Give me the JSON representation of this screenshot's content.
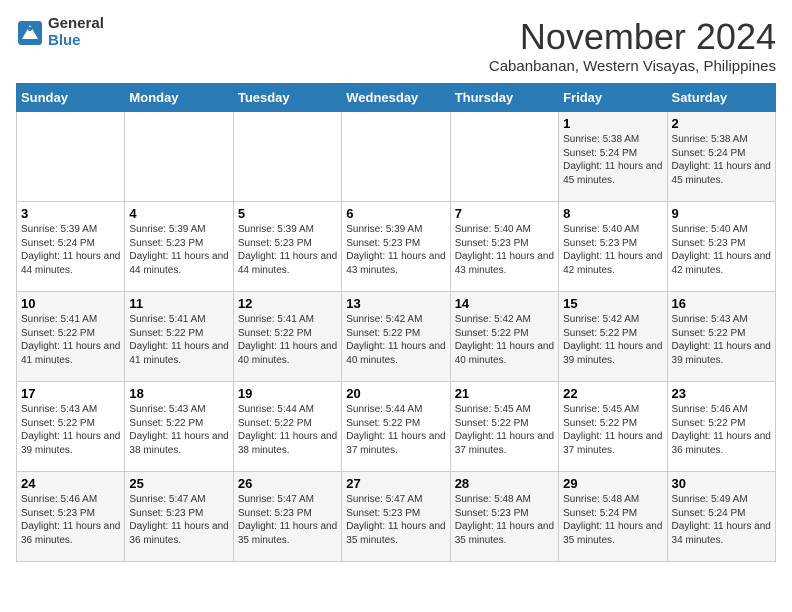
{
  "logo": {
    "general": "General",
    "blue": "Blue"
  },
  "header": {
    "month": "November 2024",
    "location": "Cabanbanan, Western Visayas, Philippines"
  },
  "weekdays": [
    "Sunday",
    "Monday",
    "Tuesday",
    "Wednesday",
    "Thursday",
    "Friday",
    "Saturday"
  ],
  "weeks": [
    [
      {
        "day": "",
        "info": ""
      },
      {
        "day": "",
        "info": ""
      },
      {
        "day": "",
        "info": ""
      },
      {
        "day": "",
        "info": ""
      },
      {
        "day": "",
        "info": ""
      },
      {
        "day": "1",
        "info": "Sunrise: 5:38 AM\nSunset: 5:24 PM\nDaylight: 11 hours and 45 minutes."
      },
      {
        "day": "2",
        "info": "Sunrise: 5:38 AM\nSunset: 5:24 PM\nDaylight: 11 hours and 45 minutes."
      }
    ],
    [
      {
        "day": "3",
        "info": "Sunrise: 5:39 AM\nSunset: 5:24 PM\nDaylight: 11 hours and 44 minutes."
      },
      {
        "day": "4",
        "info": "Sunrise: 5:39 AM\nSunset: 5:23 PM\nDaylight: 11 hours and 44 minutes."
      },
      {
        "day": "5",
        "info": "Sunrise: 5:39 AM\nSunset: 5:23 PM\nDaylight: 11 hours and 44 minutes."
      },
      {
        "day": "6",
        "info": "Sunrise: 5:39 AM\nSunset: 5:23 PM\nDaylight: 11 hours and 43 minutes."
      },
      {
        "day": "7",
        "info": "Sunrise: 5:40 AM\nSunset: 5:23 PM\nDaylight: 11 hours and 43 minutes."
      },
      {
        "day": "8",
        "info": "Sunrise: 5:40 AM\nSunset: 5:23 PM\nDaylight: 11 hours and 42 minutes."
      },
      {
        "day": "9",
        "info": "Sunrise: 5:40 AM\nSunset: 5:23 PM\nDaylight: 11 hours and 42 minutes."
      }
    ],
    [
      {
        "day": "10",
        "info": "Sunrise: 5:41 AM\nSunset: 5:22 PM\nDaylight: 11 hours and 41 minutes."
      },
      {
        "day": "11",
        "info": "Sunrise: 5:41 AM\nSunset: 5:22 PM\nDaylight: 11 hours and 41 minutes."
      },
      {
        "day": "12",
        "info": "Sunrise: 5:41 AM\nSunset: 5:22 PM\nDaylight: 11 hours and 40 minutes."
      },
      {
        "day": "13",
        "info": "Sunrise: 5:42 AM\nSunset: 5:22 PM\nDaylight: 11 hours and 40 minutes."
      },
      {
        "day": "14",
        "info": "Sunrise: 5:42 AM\nSunset: 5:22 PM\nDaylight: 11 hours and 40 minutes."
      },
      {
        "day": "15",
        "info": "Sunrise: 5:42 AM\nSunset: 5:22 PM\nDaylight: 11 hours and 39 minutes."
      },
      {
        "day": "16",
        "info": "Sunrise: 5:43 AM\nSunset: 5:22 PM\nDaylight: 11 hours and 39 minutes."
      }
    ],
    [
      {
        "day": "17",
        "info": "Sunrise: 5:43 AM\nSunset: 5:22 PM\nDaylight: 11 hours and 39 minutes."
      },
      {
        "day": "18",
        "info": "Sunrise: 5:43 AM\nSunset: 5:22 PM\nDaylight: 11 hours and 38 minutes."
      },
      {
        "day": "19",
        "info": "Sunrise: 5:44 AM\nSunset: 5:22 PM\nDaylight: 11 hours and 38 minutes."
      },
      {
        "day": "20",
        "info": "Sunrise: 5:44 AM\nSunset: 5:22 PM\nDaylight: 11 hours and 37 minutes."
      },
      {
        "day": "21",
        "info": "Sunrise: 5:45 AM\nSunset: 5:22 PM\nDaylight: 11 hours and 37 minutes."
      },
      {
        "day": "22",
        "info": "Sunrise: 5:45 AM\nSunset: 5:22 PM\nDaylight: 11 hours and 37 minutes."
      },
      {
        "day": "23",
        "info": "Sunrise: 5:46 AM\nSunset: 5:22 PM\nDaylight: 11 hours and 36 minutes."
      }
    ],
    [
      {
        "day": "24",
        "info": "Sunrise: 5:46 AM\nSunset: 5:23 PM\nDaylight: 11 hours and 36 minutes."
      },
      {
        "day": "25",
        "info": "Sunrise: 5:47 AM\nSunset: 5:23 PM\nDaylight: 11 hours and 36 minutes."
      },
      {
        "day": "26",
        "info": "Sunrise: 5:47 AM\nSunset: 5:23 PM\nDaylight: 11 hours and 35 minutes."
      },
      {
        "day": "27",
        "info": "Sunrise: 5:47 AM\nSunset: 5:23 PM\nDaylight: 11 hours and 35 minutes."
      },
      {
        "day": "28",
        "info": "Sunrise: 5:48 AM\nSunset: 5:23 PM\nDaylight: 11 hours and 35 minutes."
      },
      {
        "day": "29",
        "info": "Sunrise: 5:48 AM\nSunset: 5:24 PM\nDaylight: 11 hours and 35 minutes."
      },
      {
        "day": "30",
        "info": "Sunrise: 5:49 AM\nSunset: 5:24 PM\nDaylight: 11 hours and 34 minutes."
      }
    ]
  ]
}
